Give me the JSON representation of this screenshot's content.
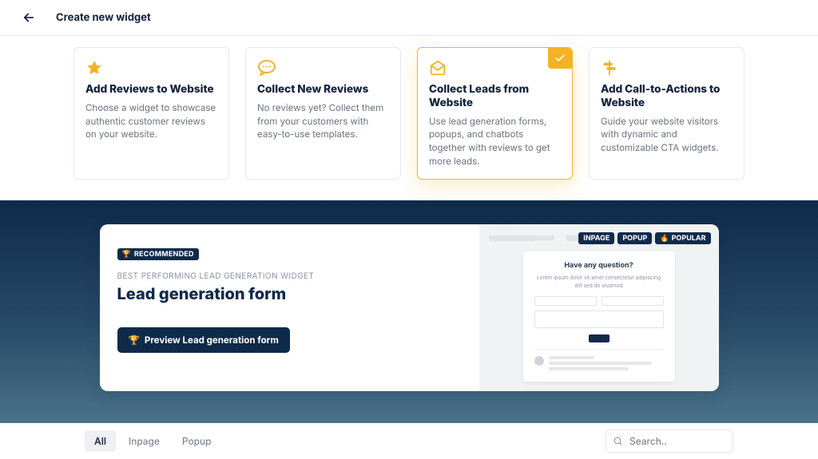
{
  "header": {
    "title": "Create new widget"
  },
  "cards": [
    {
      "icon": "star-icon",
      "title": "Add Reviews to Website",
      "desc": "Choose a widget to showcase authentic customer reviews on your website.",
      "selected": false
    },
    {
      "icon": "chat-icon",
      "title": "Collect New Reviews",
      "desc": "No reviews yet? Collect them from your customers with easy-to-use templates.",
      "selected": false
    },
    {
      "icon": "envelope-open-icon",
      "title": "Collect Leads from Website",
      "desc": "Use lead generation forms, popups, and chatbots together with reviews to get more leads.",
      "selected": true
    },
    {
      "icon": "signpost-icon",
      "title": "Add Call-to-Actions to Website",
      "desc": "Guide your website visitors with dynamic and customizable CTA widgets.",
      "selected": false
    }
  ],
  "hero": {
    "badge_emoji": "🏆",
    "badge_label": "RECOMMENDED",
    "subheading": "BEST PERFORMING LEAD GENERATION WIDGET",
    "title": "Lead generation form",
    "cta_emoji": "🏆",
    "cta_label": "Preview Lead generation form",
    "tags": [
      {
        "label": "INPAGE",
        "hot": false
      },
      {
        "label": "POPUP",
        "hot": false
      },
      {
        "label": "POPULAR",
        "hot": true
      }
    ],
    "mock": {
      "title": "Have any question?",
      "subtitle": "Lorem ipsum dolor sit amet consectetur adipiscing elit sed do eiusmod"
    }
  },
  "filter": {
    "tabs": [
      {
        "label": "All",
        "active": true
      },
      {
        "label": "Inpage",
        "active": false
      },
      {
        "label": "Popup",
        "active": false
      }
    ],
    "search_placeholder": "Search.."
  }
}
